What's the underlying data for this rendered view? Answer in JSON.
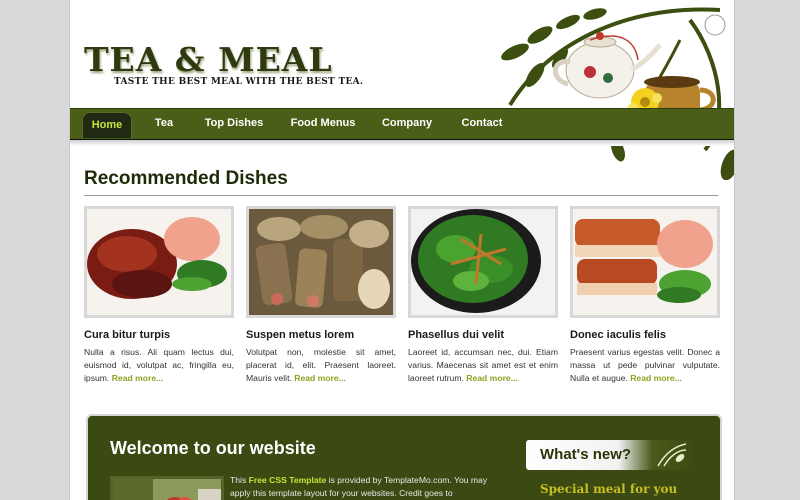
{
  "header": {
    "title": "TEA & MEAL",
    "tagline": "TASTE THE BEST MEAL WITH THE BEST TEA."
  },
  "nav": {
    "items": [
      {
        "label": "Home",
        "active": true
      },
      {
        "label": "Tea"
      },
      {
        "label": "Top Dishes"
      },
      {
        "label": "Food Menus"
      },
      {
        "label": "Company"
      },
      {
        "label": "Contact"
      }
    ]
  },
  "recommended": {
    "heading": "Recommended Dishes",
    "read_more": "Read more...",
    "dishes": [
      {
        "name": "Cura bitur turpis",
        "desc": "Nulla a risus. Ali quam lectus dui, euismod id, volutpat ac, fringilla eu, ipsum."
      },
      {
        "name": "Suspen metus lorem",
        "desc": "Volutpat non, molestie sit amet, placerat id, elit. Praesent laoreet. Mauris velit."
      },
      {
        "name": "Phasellus dui velit",
        "desc": "Laoreet id, accumsan nec, dui. Etiam varius. Maecenas sit amet est et enim laoreet rutrum."
      },
      {
        "name": "Donec iaculis felis",
        "desc": "Praesent varius egestas velit. Donec a massa ut pede pulvinar vulputate. Nulla et augue."
      }
    ]
  },
  "welcome": {
    "heading": "Welcome to our website",
    "text_before": "This ",
    "text_highlight": "Free CSS Template",
    "text_after": " is provided by TemplateMo.com. You may apply this template layout for your websites. Credit goes to"
  },
  "sidebar": {
    "whats_new": "What's new?",
    "special": "Special meal for you"
  },
  "colors": {
    "nav_bg": "#4a5e18",
    "accent": "#c8e33a",
    "panel_bg": "#3a4a12",
    "read_more": "#8f9f1c"
  }
}
